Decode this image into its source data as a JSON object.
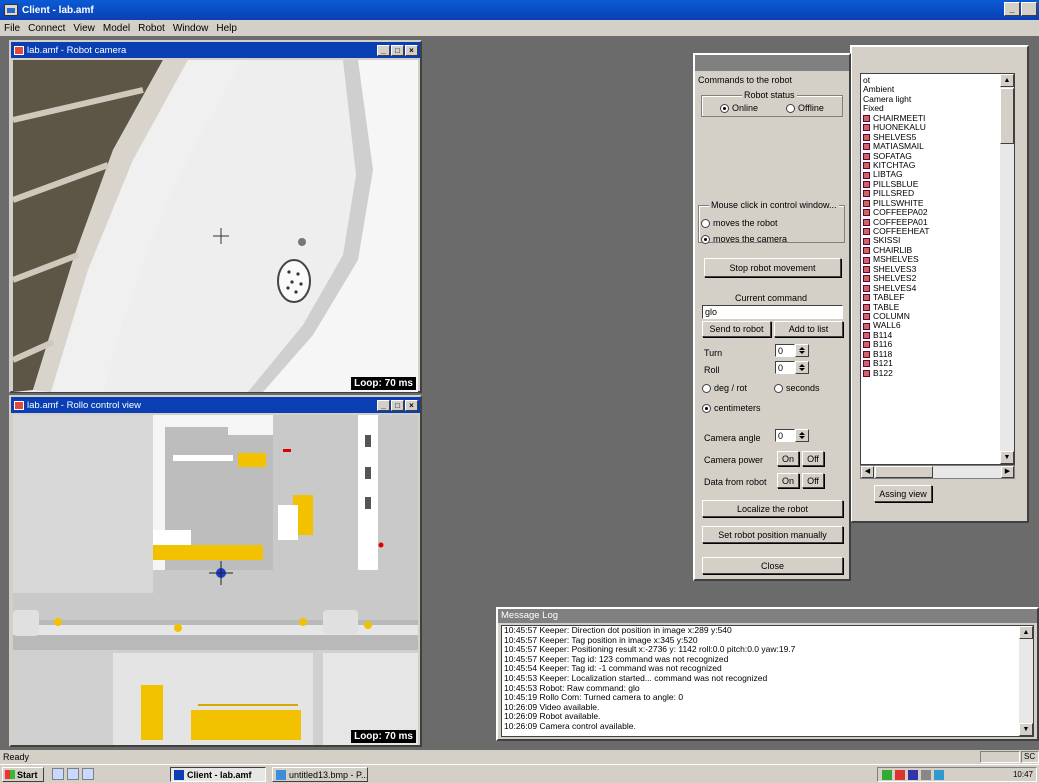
{
  "app": {
    "title": "Client - lab.amf",
    "window_buttons": [
      "_",
      " ",
      "×"
    ]
  },
  "menu": [
    "File",
    "Connect",
    "View",
    "Model",
    "Robot",
    "Window",
    "Help"
  ],
  "camera_window": {
    "title": "lab.amf - Robot camera",
    "loop": "Loop: 70 ms"
  },
  "control_window": {
    "title": "lab.amf - Rollo control view",
    "loop": "Loop: 70 ms"
  },
  "commands": {
    "title": "Commands to the robot",
    "robot_status": "Robot status",
    "online": "Online",
    "offline": "Offline",
    "mouse_group": "Mouse click in control window...",
    "moves_robot": "moves the robot",
    "moves_camera": "moves the camera",
    "stop": "Stop robot movement",
    "current_command": "Current command",
    "command_value": "glo",
    "send": "Send to robot",
    "add_list": "Add to list",
    "turn": "Turn",
    "turn_value": "0",
    "roll": "Roll",
    "roll_value": "0",
    "deg_rot": "deg / rot",
    "seconds": "seconds",
    "centimeters": "centimeters",
    "camera_angle": "Camera angle",
    "camera_angle_value": "0",
    "camera_power": "Camera power",
    "data_from_robot": "Data from robot",
    "on": "On",
    "off": "Off",
    "localize": "Localize the robot",
    "set_position": "Set robot position manually",
    "close": "Close"
  },
  "object_list": {
    "items": [
      {
        "label": "ot",
        "icon": false
      },
      {
        "label": "Ambient",
        "icon": false
      },
      {
        "label": "Camera light",
        "icon": false
      },
      {
        "label": "Fixed",
        "icon": false
      },
      {
        "label": "CHAIRMEETI",
        "icon": true
      },
      {
        "label": "HUONEKALU",
        "icon": true
      },
      {
        "label": "SHELVES5",
        "icon": true
      },
      {
        "label": "MATIASMAIL",
        "icon": true
      },
      {
        "label": "SOFATAG",
        "icon": true
      },
      {
        "label": "KITCHTAG",
        "icon": true
      },
      {
        "label": "LIBTAG",
        "icon": true
      },
      {
        "label": "PILLSBLUE",
        "icon": true
      },
      {
        "label": "PILLSRED",
        "icon": true
      },
      {
        "label": "PILLSWHITE",
        "icon": true
      },
      {
        "label": "COFFEEPA02",
        "icon": true
      },
      {
        "label": "COFFEEPA01",
        "icon": true
      },
      {
        "label": "COFFEEHEAT",
        "icon": true
      },
      {
        "label": "SKISSI",
        "icon": true
      },
      {
        "label": "CHAIRLIB",
        "icon": true
      },
      {
        "label": "MSHELVES",
        "icon": true
      },
      {
        "label": "SHELVES3",
        "icon": true
      },
      {
        "label": "SHELVES2",
        "icon": true
      },
      {
        "label": "SHELVES4",
        "icon": true
      },
      {
        "label": "TABLEF",
        "icon": true
      },
      {
        "label": "TABLE",
        "icon": true
      },
      {
        "label": "COLUMN",
        "icon": true
      },
      {
        "label": "WALL6",
        "icon": true
      },
      {
        "label": "B114",
        "icon": true
      },
      {
        "label": "B116",
        "icon": true
      },
      {
        "label": "B118",
        "icon": true
      },
      {
        "label": "B121",
        "icon": true
      },
      {
        "label": "B122",
        "icon": true
      }
    ],
    "assign_button": "Assing view"
  },
  "message_log": {
    "title": "Message Log",
    "lines": [
      "10:45:57 Keeper: Direction dot position in image x:289 y:540",
      "10:45:57 Keeper: Tag position in image x:345 y:520",
      "10:45:57 Keeper: Positioning result x:-2736 y: 1142 roll:0.0 pitch:0.0 yaw:19.7",
      "10:45:57 Keeper: Tag id: 123 command was not recognized",
      "10:45:54 Keeper: Tag id: -1 command was not recognized",
      "10:45:53 Keeper: Localization started... command was not recognized",
      "10:45:53 Robot: Raw command: glo",
      "10:45:19 Rollo Com: Turned camera to angle: 0",
      "10:26:09 Video available.",
      "10:26:09 Robot available.",
      "10:26:09 Camera control available."
    ]
  },
  "status": {
    "text": "Ready",
    "indicator": "SC"
  },
  "taskbar": {
    "start": "Start",
    "tasks": [
      "Client - lab.amf",
      "untitled13.bmp - P..."
    ],
    "clock": "10:47"
  }
}
